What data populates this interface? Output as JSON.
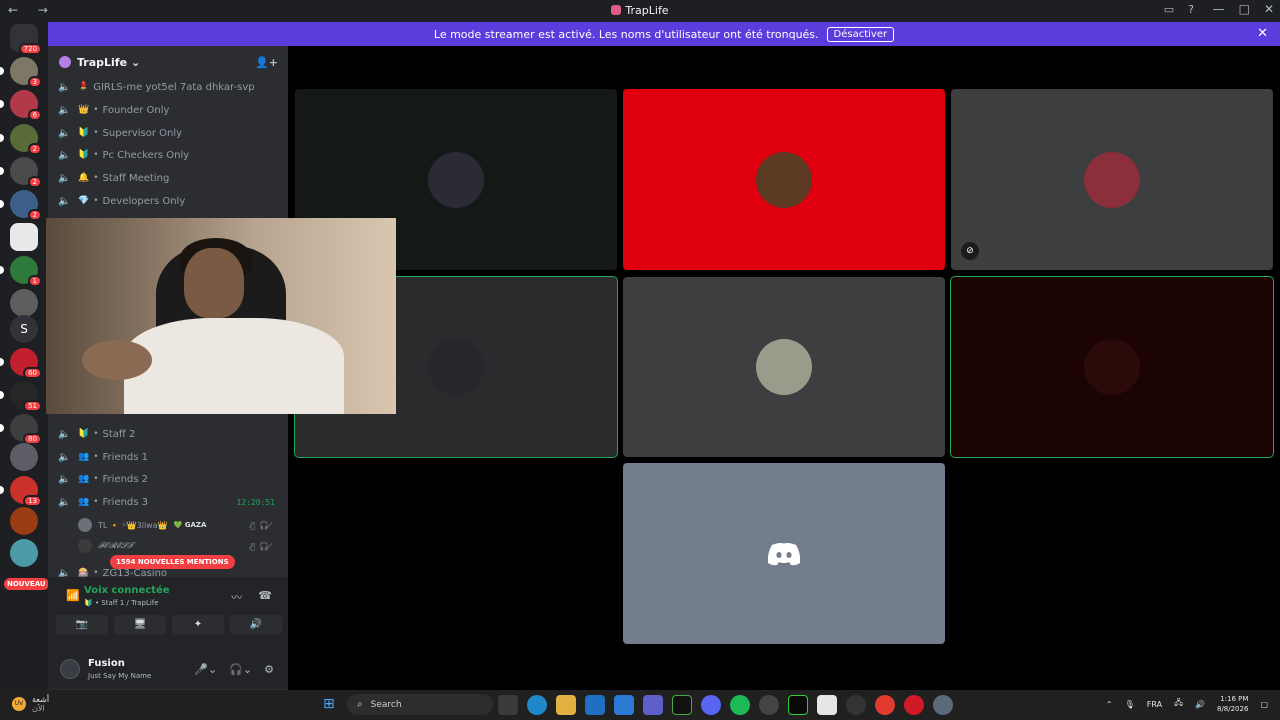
{
  "window": {
    "title": "TrapLife",
    "nav": "← →"
  },
  "banner": {
    "text": "Le mode streamer est activé. Les noms d'utilisateur ont été tronqués.",
    "button": "Désactiver"
  },
  "guild_badges": {
    "home": "720",
    "g1": "3",
    "g2": "6",
    "g3": "2",
    "g4": "2",
    "g5": "2",
    "g6": "1",
    "s_label": "S",
    "g7": "60",
    "g8": "51",
    "g9": "80",
    "g10": "13",
    "nouveau": "NOUVEAU"
  },
  "server": {
    "name": "TrapLife"
  },
  "channels": [
    {
      "label": "GIRLS-me yot5el 7ata dhkar-svp",
      "emoji": "💄"
    },
    {
      "label": "Founder Only",
      "emoji": "👑"
    },
    {
      "label": "Supervisor Only",
      "emoji": "🔰"
    },
    {
      "label": "Pc Checkers Only",
      "emoji": "🔰"
    },
    {
      "label": "Staff Meeting",
      "emoji": "🔔"
    },
    {
      "label": "Developers Only",
      "emoji": "💎"
    },
    {
      "label": "Staff 2",
      "emoji": "🔰"
    },
    {
      "label": "Friends 1",
      "emoji": "👥"
    },
    {
      "label": "Friends 2",
      "emoji": "👥"
    },
    {
      "label": "Friends 3",
      "emoji": "👥",
      "time": "12:20:51"
    },
    {
      "label": "ZG13-Casino",
      "emoji": "🎰"
    }
  ],
  "members": [
    {
      "name": "TL 🔸 ᴸᴵ👑3liwa👑",
      "tag": "💚 GAZA"
    },
    {
      "name": "𝓕𝓞𝓡𝓔𝓢𝓣",
      "tag": ""
    }
  ],
  "mentions_pill": "1594 NOUVELLES MENTIONS",
  "voice": {
    "status": "Voix connectée",
    "channel": "🔰 • Staff 1 / TrapLife"
  },
  "user": {
    "name": "Fusion",
    "status": "Just Say My Name"
  },
  "taskbar": {
    "weather_temp": "UV",
    "weather_label": "أشعة",
    "weather_sub": "الآن",
    "search_placeholder": "Search",
    "lang": "FRA",
    "time": "1:16 PM",
    "date": "8/8/2026"
  },
  "colors": {
    "accent": "#5b3cdc",
    "speaking": "#23a55a",
    "red_tile": "#e0000d",
    "grey_tile": "#3c3e40",
    "dark_red_tile": "#1c0404",
    "discord_tile": "#737c8c"
  }
}
